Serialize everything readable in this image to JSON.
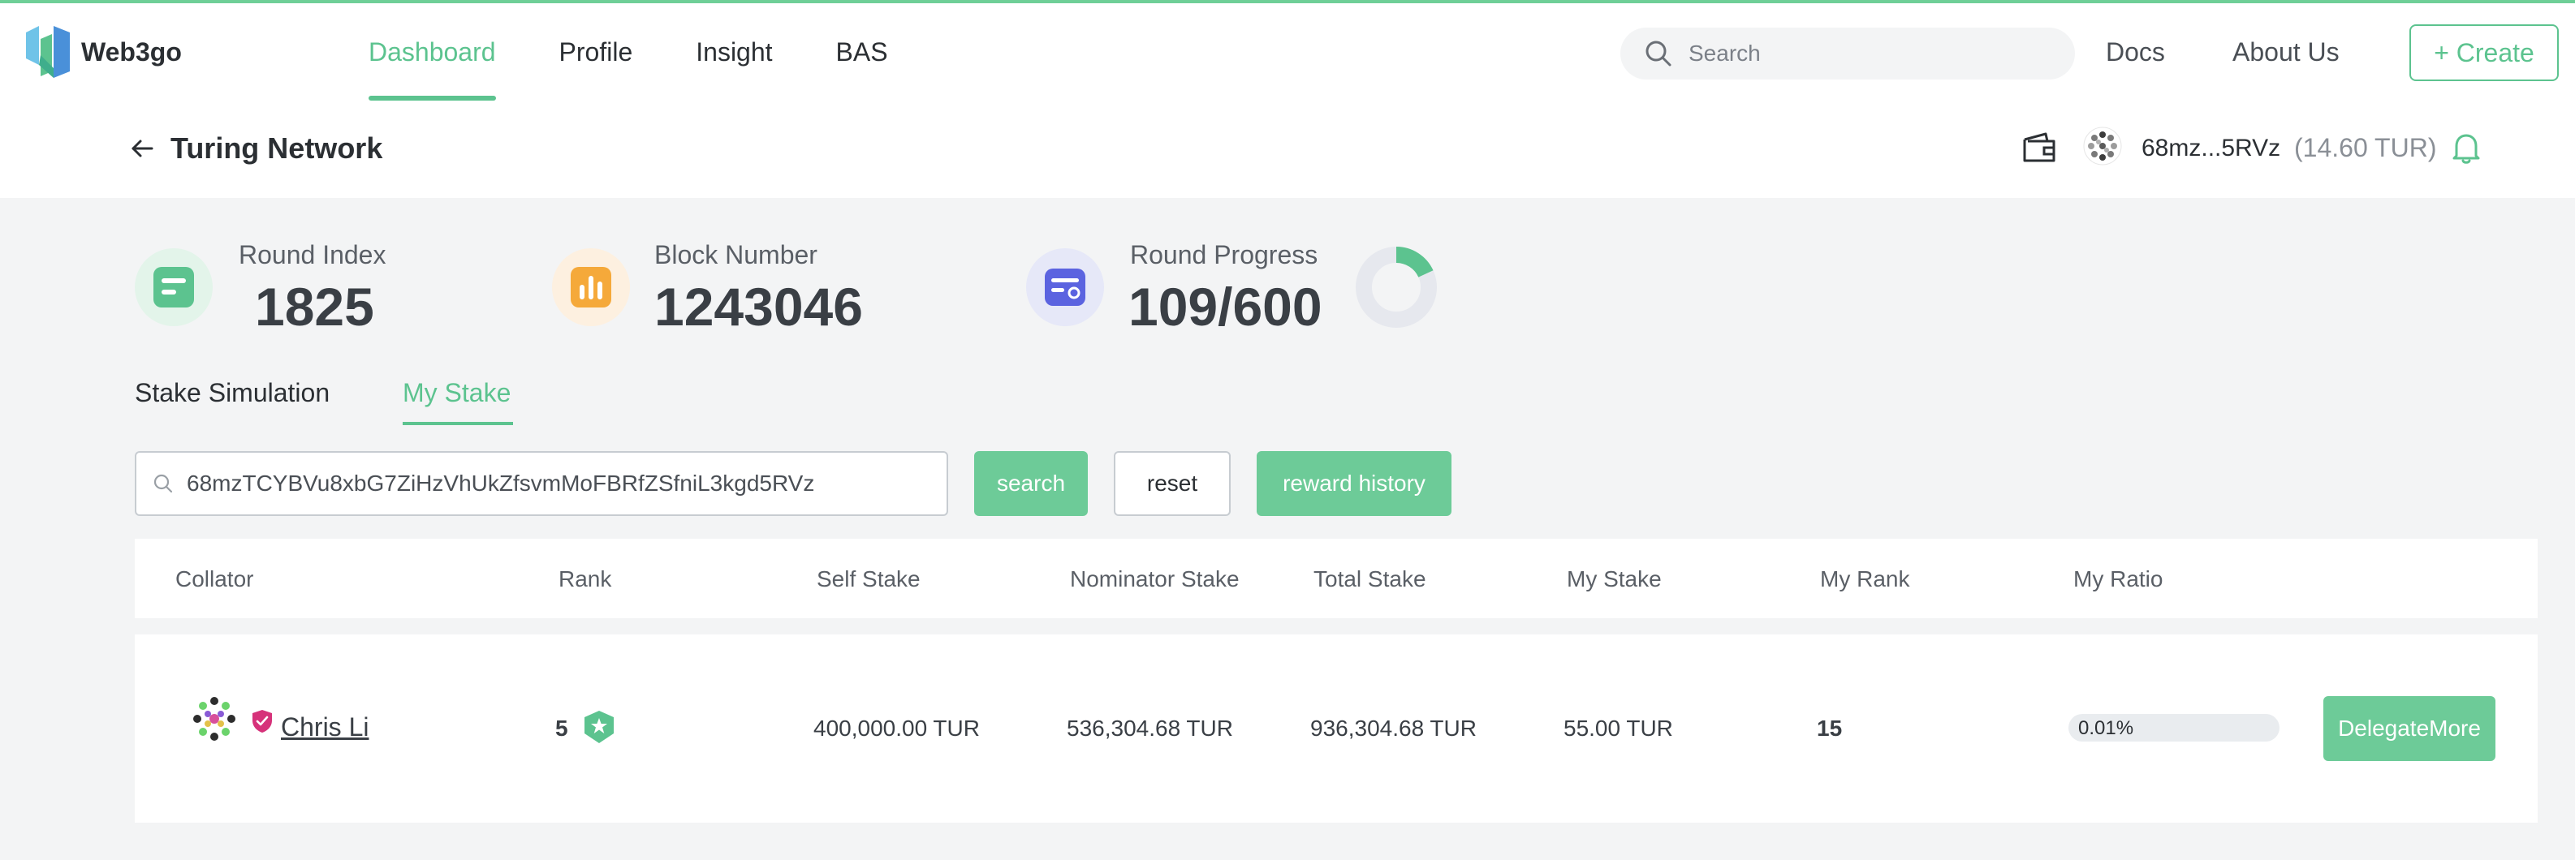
{
  "app": {
    "name": "Web3go"
  },
  "nav": {
    "items": [
      {
        "label": "Dashboard",
        "active": true
      },
      {
        "label": "Profile",
        "active": false
      },
      {
        "label": "Insight",
        "active": false
      },
      {
        "label": "BAS",
        "active": false
      }
    ]
  },
  "header": {
    "search_placeholder": "Search",
    "docs_label": "Docs",
    "about_label": "About Us",
    "create_label": "+ Create"
  },
  "subheader": {
    "title": "Turing Network",
    "account_address": "68mz...5RVz",
    "account_balance": "(14.60 TUR)"
  },
  "stats": {
    "round_index": {
      "label": "Round Index",
      "value": "1825"
    },
    "block_number": {
      "label": "Block Number",
      "value": "1243046"
    },
    "round_progress": {
      "label": "Round Progress",
      "value": "109/600",
      "fraction": 0.1817
    }
  },
  "tabs": [
    {
      "label": "Stake Simulation",
      "active": false
    },
    {
      "label": "My Stake",
      "active": true
    }
  ],
  "query": {
    "address_value": "68mzTCYBVu8xbG7ZiHzVhUkZfsvmMoFBRfZSfniL3kgd5RVz",
    "search_label": "search",
    "reset_label": "reset",
    "reward_history_label": "reward history"
  },
  "table": {
    "columns": [
      "Collator",
      "Rank",
      "Self Stake",
      "Nominator Stake",
      "Total Stake",
      "My Stake",
      "My Rank",
      "My Ratio"
    ],
    "rows": [
      {
        "collator": "Chris Li",
        "rank": "5",
        "self_stake": "400,000.00 TUR",
        "nominator_stake": "536,304.68 TUR",
        "total_stake": "936,304.68 TUR",
        "my_stake": "55.00 TUR",
        "my_rank": "15",
        "my_ratio": "0.01%",
        "my_ratio_fraction": 0.0001,
        "action_label": "DelegateMore"
      }
    ]
  },
  "colors": {
    "accent": "#5cc38f",
    "button_green": "#6dcb98",
    "round_index_bg": "#e3f4ea",
    "block_number_bg": "#fdf0e0",
    "round_progress_bg": "#e6e8f8"
  }
}
